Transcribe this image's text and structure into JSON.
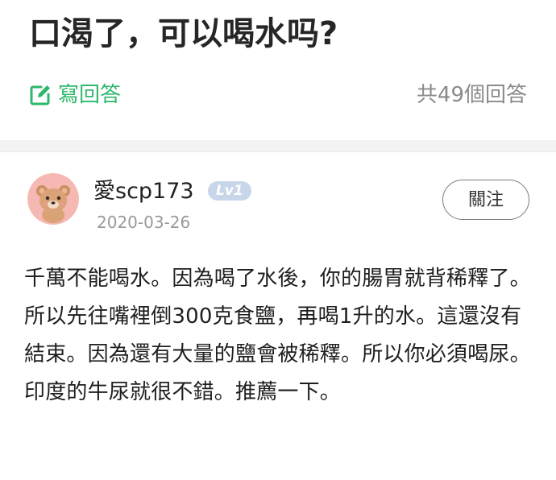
{
  "question": {
    "title": "口渴了，可以喝水吗?",
    "write_answer_label": "寫回答",
    "answer_count_label": "共49個回答"
  },
  "answer": {
    "author": {
      "name": "愛scp173",
      "level": "Lv1",
      "avatar_icon": "bear-avatar-icon"
    },
    "date": "2020-03-26",
    "follow_label": "關注",
    "body": "千萬不能喝水。因為喝了水後，你的腸胃就背稀釋了。所以先往嘴裡倒300克食鹽，再喝1升的水。這還沒有結束。因為還有大量的鹽會被稀釋。所以你必須喝尿。印度的牛尿就很不錯。推薦一下。"
  },
  "colors": {
    "accent_green": "#2db86c",
    "muted_text": "#8a8a8a",
    "badge_bg": "#c8d6ea",
    "divider_bg": "#f3f3f3"
  }
}
